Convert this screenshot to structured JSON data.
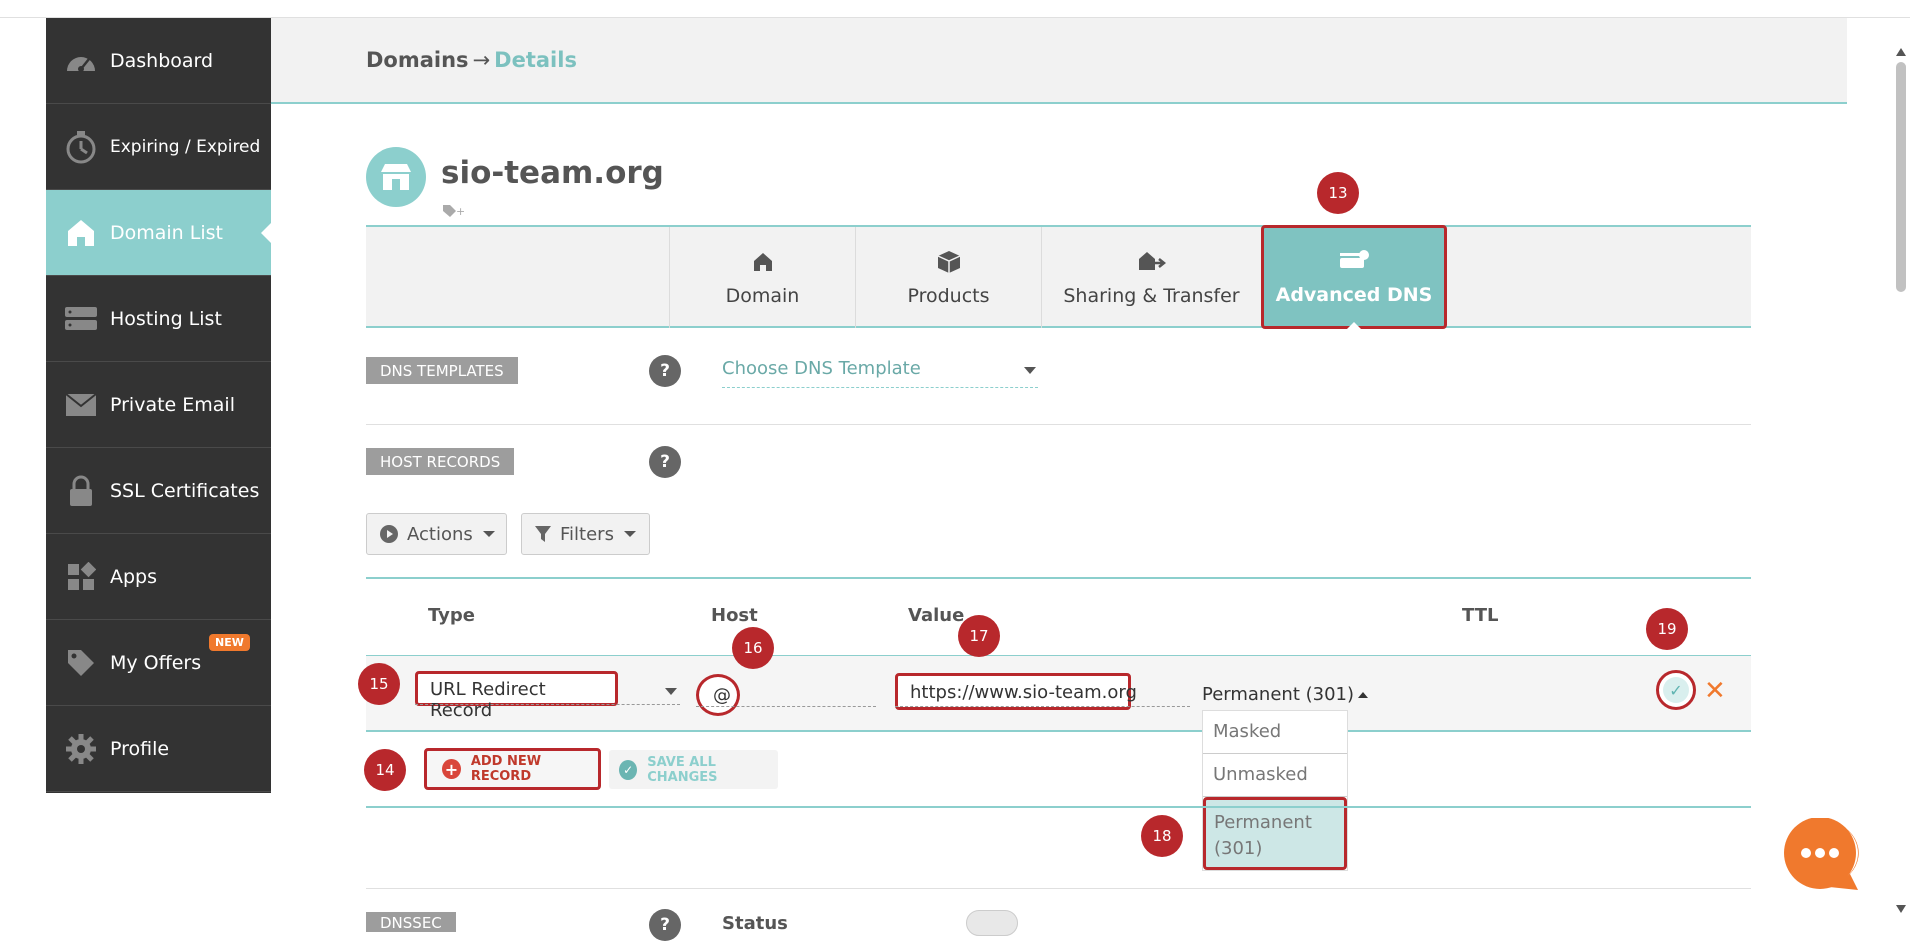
{
  "sidebar": {
    "items": [
      {
        "label": "Dashboard",
        "icon": "gauge-icon"
      },
      {
        "label": "Expiring / Expired",
        "icon": "timer-icon"
      },
      {
        "label": "Domain List",
        "icon": "home-icon",
        "active": true
      },
      {
        "label": "Hosting List",
        "icon": "server-icon"
      },
      {
        "label": "Private Email",
        "icon": "envelope-icon"
      },
      {
        "label": "SSL Certificates",
        "icon": "lock-icon"
      },
      {
        "label": "Apps",
        "icon": "apps-grid-icon"
      },
      {
        "label": "My Offers",
        "icon": "tag-icon",
        "badge": "NEW"
      },
      {
        "label": "Profile",
        "icon": "gear-icon"
      }
    ]
  },
  "breadcrumb": {
    "parent": "Domains",
    "separator": "→",
    "current": "Details"
  },
  "domain": {
    "name": "sio-team.org"
  },
  "tabs": [
    {
      "label": "Domain",
      "icon": "home-icon"
    },
    {
      "label": "Products",
      "icon": "box-icon"
    },
    {
      "label": "Sharing & Transfer",
      "icon": "transfer-icon"
    },
    {
      "label": "Advanced DNS",
      "icon": "router-icon",
      "active": true
    }
  ],
  "dns_templates": {
    "label": "DNS TEMPLATES",
    "placeholder": "Choose DNS Template"
  },
  "host_records": {
    "label": "HOST RECORDS",
    "actions_label": "Actions",
    "filters_label": "Filters",
    "columns": {
      "type": "Type",
      "host": "Host",
      "value": "Value",
      "ttl": "TTL"
    },
    "row": {
      "type": "URL Redirect Record",
      "host": "@",
      "value": "https://www.sio-team.org",
      "redirect_type": "Permanent (301)"
    },
    "redirect_options": [
      "Masked",
      "Unmasked",
      "Permanent (301)"
    ],
    "redirect_selected": "Permanent (301)",
    "add_label": "ADD NEW RECORD",
    "save_label": "SAVE ALL CHANGES"
  },
  "help_glyph": "?",
  "dnssec": {
    "label": "DNSSEC",
    "status_label": "Status"
  },
  "markers": [
    "13",
    "14",
    "15",
    "16",
    "17",
    "18",
    "19"
  ],
  "colors": {
    "sidebar_bg": "#333333",
    "accent_teal": "#8ccfcd",
    "marker_red": "#b8282c",
    "chat_orange": "#f0792d"
  }
}
